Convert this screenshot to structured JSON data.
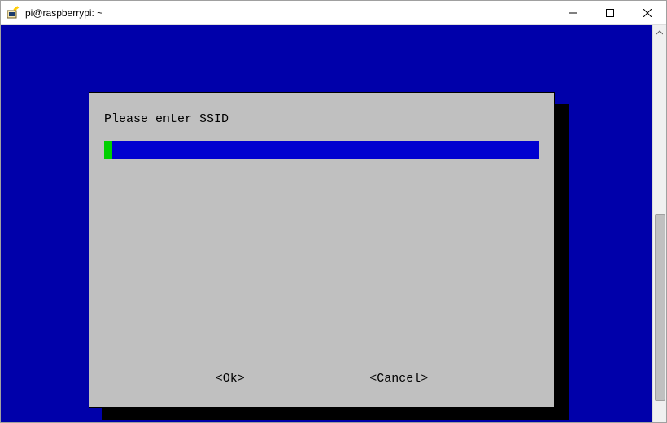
{
  "window": {
    "title": "pi@raspberrypi: ~"
  },
  "dialog": {
    "prompt_label": "Please enter SSID",
    "input_value": "",
    "ok_label": "<Ok>",
    "cancel_label": "<Cancel>"
  }
}
